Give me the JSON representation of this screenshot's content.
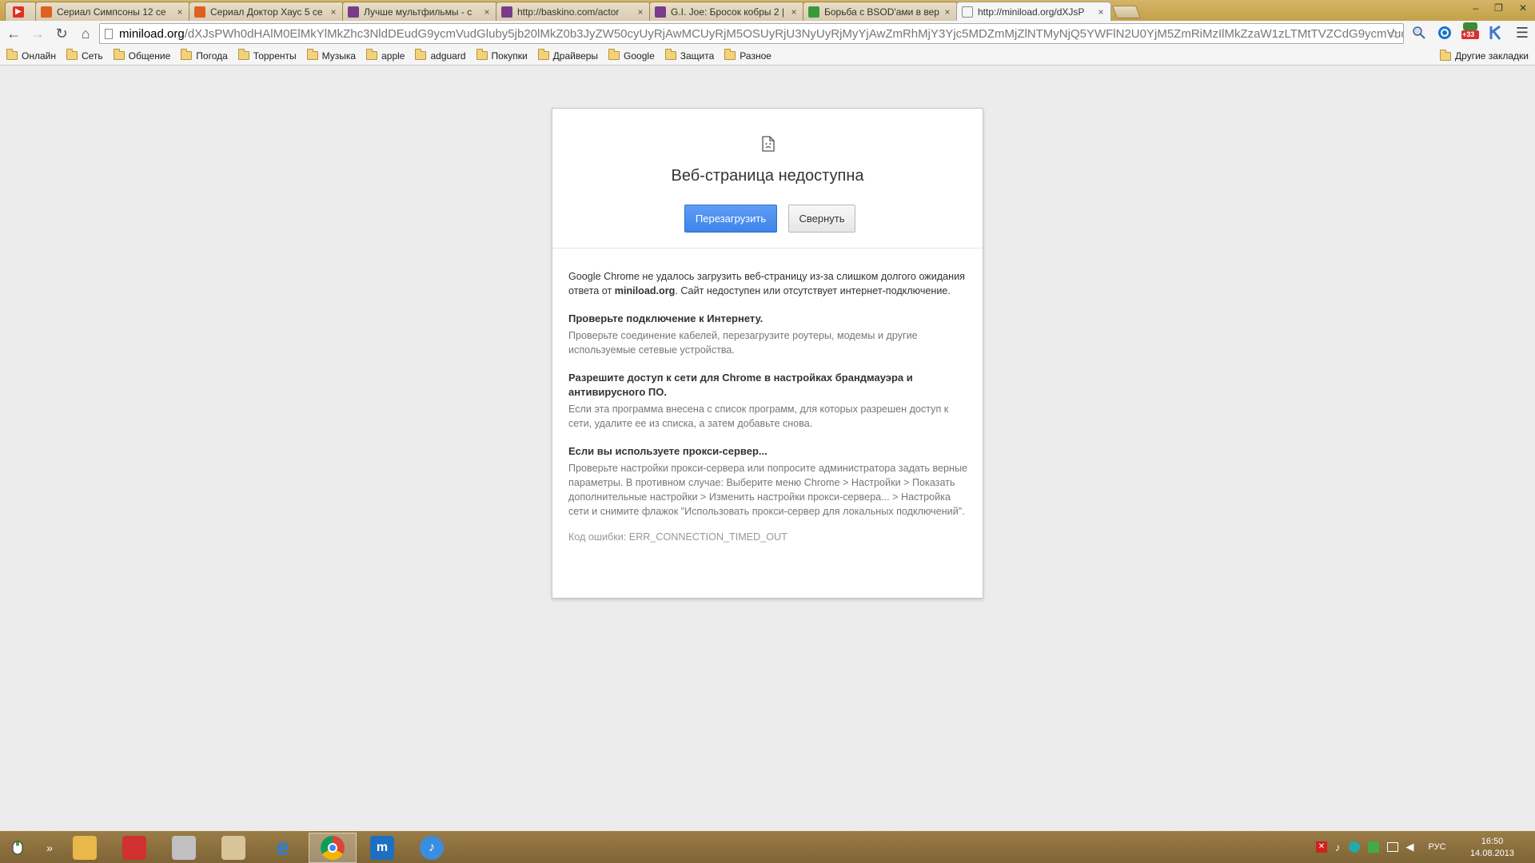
{
  "tabs": [
    {
      "title": "",
      "icon": "youtube-icon",
      "color": "#e52d27"
    },
    {
      "title": "Сериал Симпсоны 12 се",
      "icon": "flame-site-icon",
      "color": "#e06020"
    },
    {
      "title": "Сериал Доктор Хаус 5 се",
      "icon": "flame-site-icon",
      "color": "#e06020"
    },
    {
      "title": "Лучше мультфильмы - с",
      "icon": "film-site-icon",
      "color": "#7a3b8a"
    },
    {
      "title": "http://baskino.com/actor",
      "icon": "film-site-icon",
      "color": "#7a3b8a"
    },
    {
      "title": "G.I. Joe: Бросок кобры 2 |",
      "icon": "film-site-icon",
      "color": "#7a3b8a"
    },
    {
      "title": "Борьба с BSOD'ами в вер",
      "icon": "shield-site-icon",
      "color": "#3a9a3a"
    },
    {
      "title": "http://miniload.org/dXJsP",
      "icon": "page-icon",
      "color": "#999999"
    }
  ],
  "window_controls": {
    "minimize": "–",
    "maximize": "❐",
    "close": "✕"
  },
  "toolbar": {
    "back": "←",
    "forward": "→",
    "reload": "↻",
    "home": "⌂",
    "url_host": "miniload.org",
    "url_rest": "/dXJsPWh0dHAlM0ElMkYlMkZhc3NldDEudG9ycmVudGluby5jb20lMkZ0b3JyZW50cyUyRjAwMCUyRjM5OSUyRjU3NyUyRjMyYjAwZmRhMjY3Yjc5MDZmMjZlNTMyNjQ5YWFlN2U0YjM5ZmRiMzIlMkZzaW1zLTMtTVZCdG9ycmVudGlu",
    "star": "☆",
    "menu": "☰",
    "badge": "+33"
  },
  "bookmarks": [
    "Онлайн",
    "Сеть",
    "Общение",
    "Погода",
    "Торренты",
    "Музыка",
    "apple",
    "adguard",
    "Покупки",
    "Драйверы",
    "Google",
    "Защита",
    "Разное"
  ],
  "bookmarks_other": "Другие закладки",
  "error": {
    "title": "Веб-страница недоступна",
    "reload_button": "Перезагрузить",
    "collapse_button": "Свернуть",
    "intro_pre": "Google Chrome не удалось загрузить веб-страницу из-за слишком долгого ожидания ответа от ",
    "intro_host": "miniload.org",
    "intro_post": ". Сайт недоступен или отсутствует интернет-подключение.",
    "sections": [
      {
        "heading": "Проверьте подключение к Интернету.",
        "text": "Проверьте соединение кабелей, перезагрузите роутеры, модемы и другие используемые сетевые устройства."
      },
      {
        "heading": "Разрешите доступ к сети для Chrome в настройках брандмауэра и антивирусного ПО.",
        "text": "Если эта программа внесена с список программ, для которых разрешен доступ к сети, удалите ее из списка, а затем добавьте снова."
      },
      {
        "heading": "Если вы используете прокси-сервер...",
        "text": "Проверьте настройки прокси-сервера или попросите администратора задать верные параметры. В противном случае: Выберите меню Chrome > Настройки > Показать дополнительные настройки > Изменить настройки прокси-сервера... > Настройка сети и снимите флажок \"Использовать прокси-сервер для локальных подключений\"."
      }
    ],
    "error_code": "Код ошибки: ERR_CONNECTION_TIMED_OUT"
  },
  "taskbar": {
    "apps": [
      {
        "name": "file-explorer-icon",
        "color": "#e8b84a"
      },
      {
        "name": "app-red-green-icon",
        "color": "#d03030"
      },
      {
        "name": "app-paint-icon",
        "color": "#c0c0c0"
      },
      {
        "name": "app-brush-icon",
        "color": "#d9c49a"
      },
      {
        "name": "internet-explorer-icon",
        "color": "#2a7fd4"
      },
      {
        "name": "chrome-icon",
        "color": "#db4437"
      },
      {
        "name": "maxthon-icon",
        "color": "#1e6fc0"
      },
      {
        "name": "itunes-icon",
        "color": "#3a8ee0"
      }
    ],
    "lang": "РУС",
    "time": "16:50",
    "date": "14.08.2013",
    "overflow": "»"
  }
}
